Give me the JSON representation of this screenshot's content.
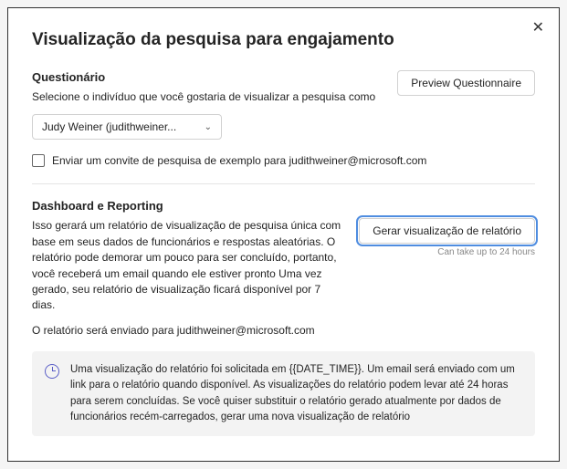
{
  "dialog": {
    "title": "Visualização da pesquisa para engajamento"
  },
  "questionnaire": {
    "section_title": "Questionário",
    "desc": "Selecione o indivíduo que você gostaria de visualizar a pesquisa como",
    "preview_btn": "Preview Questionnaire",
    "dropdown_value": "Judy Weiner (judithweiner...",
    "checkbox_label": "Enviar um convite de pesquisa de exemplo para judithweiner@microsoft.com"
  },
  "dashboard": {
    "section_title": "Dashboard e Reporting",
    "desc": "Isso gerará um relatório de visualização de pesquisa única com base em seus dados de funcionários e respostas aleatórias. O relatório pode demorar um pouco para ser concluído, portanto, você receberá um email quando ele estiver pronto Uma vez gerado, seu relatório de visualização ficará disponível por 7 dias.",
    "generate_btn": "Gerar visualização de relatório",
    "hint": "Can take up to 24 hours",
    "sent_to": "O relatório será enviado para judithweiner@microsoft.com",
    "info": "Uma visualização do relatório foi solicitada em {{DATE_TIME}}. Um email será enviado com um link para o relatório quando disponível. As visualizações do relatório podem levar até 24 horas para serem concluídas. Se você quiser substituir o relatório gerado atualmente por dados de funcionários recém-carregados, gerar uma nova visualização de relatório"
  }
}
